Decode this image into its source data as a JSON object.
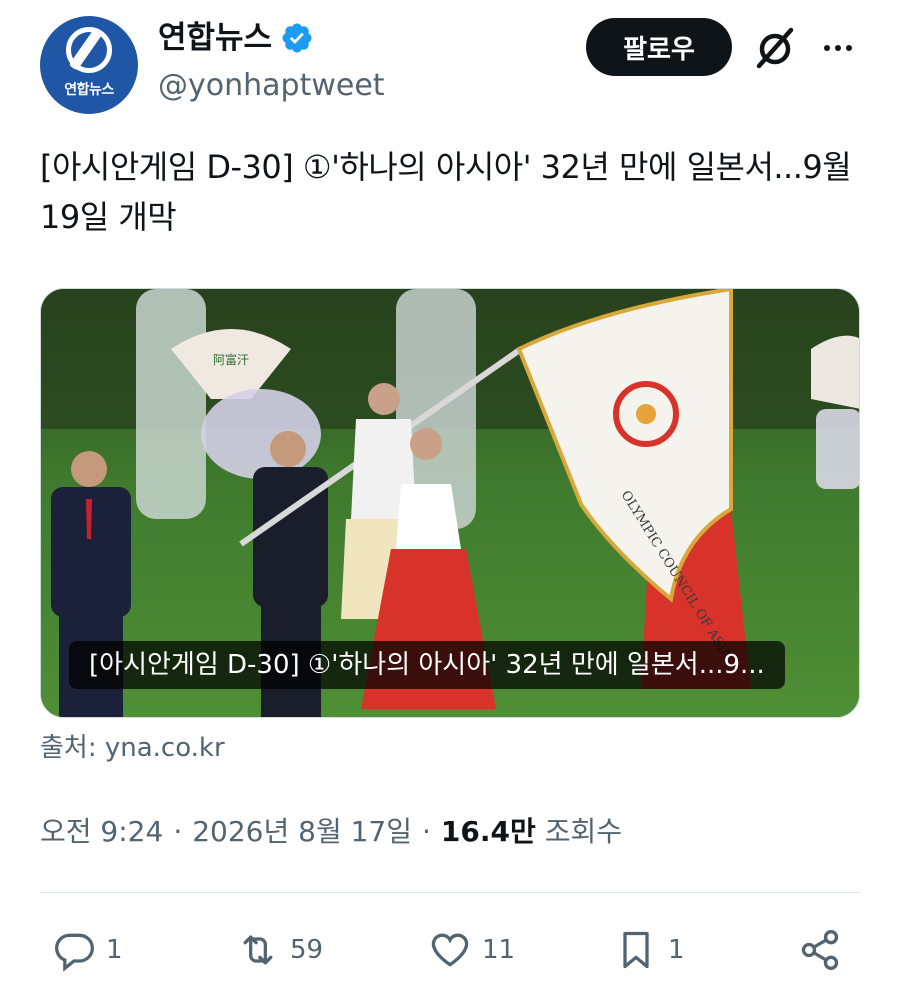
{
  "account": {
    "display_name": "연합뉴스",
    "handle": "@yonhaptweet",
    "avatar_label": "연합뉴스",
    "verified_color": "#1d9bf0"
  },
  "header": {
    "follow_label": "팔로우",
    "grok_icon": "grok-icon",
    "more_icon": "more-icon"
  },
  "post": {
    "text": "[아시안게임 D-30] ①'하나의 아시아' 32년 만에 일본서...9월 19일 개막",
    "card_caption": "[아시안게임 D-30] ①'하나의 아시아' 32년 만에 일본서...9...",
    "source": "출처: yna.co.kr",
    "flag_text": "OLYMPIC COUNCIL OF ASIA"
  },
  "meta": {
    "time": "오전 9:24",
    "separator": "·",
    "date": "2026년 8월 17일",
    "views": "16.4만",
    "views_label": "조회수"
  },
  "actions": {
    "reply_count": "1",
    "retweet_count": "59",
    "like_count": "11",
    "bookmark_count": "1"
  },
  "colors": {
    "text": "#0f1419",
    "muted": "#536471",
    "accent": "#1d9bf0",
    "brand": "#1f57a6"
  }
}
